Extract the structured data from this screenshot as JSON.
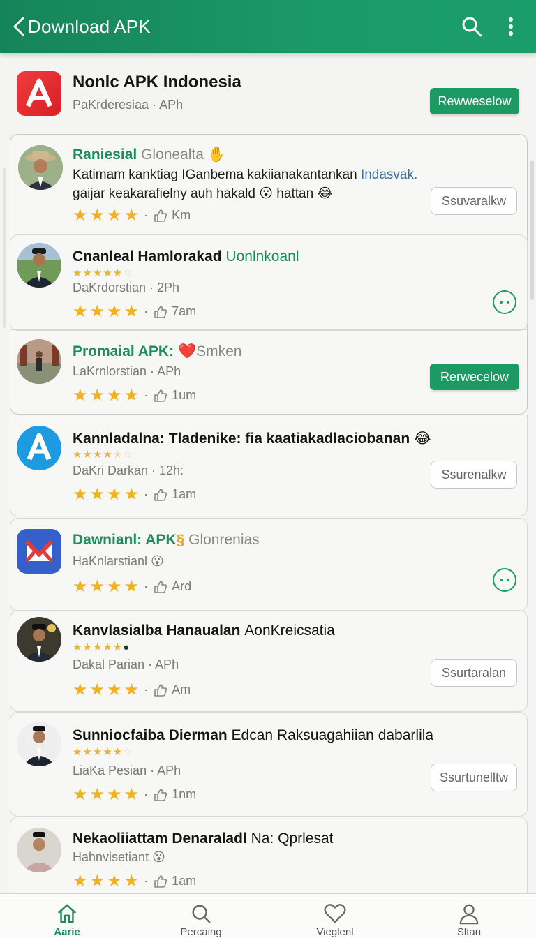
{
  "header": {
    "title": "Download APK"
  },
  "hero": {
    "name": "Nonlc APK Indonesia",
    "sub": "PaKrderesiaa · APh",
    "button": "Rewweselow"
  },
  "items": [
    {
      "title_a": "Raniesial",
      "title_b": "Glonealta",
      "line1_a": "Katimam kanktiag IGanbema kakiianakantankan ",
      "line1_b": "Indasvak.",
      "line2": "gaijar keakarafielny auh hakald 😮 hattan 😂",
      "stars": "★★★★",
      "likes": "Km",
      "button": "Ssuvaralkw"
    },
    {
      "title_a": "Cnanleal Hamlorakad ",
      "title_b": "Uonlnkoanl",
      "sub": "DaKrdorstian · 2Ph",
      "stars": "★★★★",
      "likes": "7am"
    },
    {
      "title_a": "Promaial APK:",
      "title_b": "❤️Smken",
      "sub": "LaKrnlorstian · APh",
      "stars": "★★★★",
      "likes": "1um",
      "button": "Rerwecelow"
    },
    {
      "title": "Kannladalna: Tladenike: fia kaatiakadlaciobanan 😂",
      "sub": "DaKri Darkan · 12h:",
      "stars": "★★★★",
      "likes": "1am",
      "button": "Ssurenalkw"
    },
    {
      "title_a": "Dawnianl: APK",
      "title_b": "Glonrenias",
      "sub": "HaKnlarstianl 😮",
      "stars": "★★★★",
      "likes": "Ard"
    },
    {
      "title_a": "Kanvlasialba Hanaualan ",
      "title_b": "AonKreicsatia",
      "sub": "Dakal Parian · APh",
      "stars": "★★★★",
      "likes": "Am",
      "button": "Ssurtaralan"
    },
    {
      "title_a": "Sunniocfaiba Dierman ",
      "title_b": "Edcan Raksuagahiian dabarlila",
      "sub": "LiaKa Pesian · APh",
      "stars": "★★★★",
      "likes": "1nm",
      "button": "Ssurtunelltw"
    },
    {
      "title_a": "Nekaoliiattam Denaraladl ",
      "title_b": "Na: Qprlesat",
      "sub": "Hahnvisetiant 😮",
      "stars": "★★★★",
      "likes": "1am"
    }
  ],
  "nav": [
    {
      "label": "Aarie"
    },
    {
      "label": "Percaing"
    },
    {
      "label": "Vieglenl"
    },
    {
      "label": "Sltan"
    }
  ]
}
